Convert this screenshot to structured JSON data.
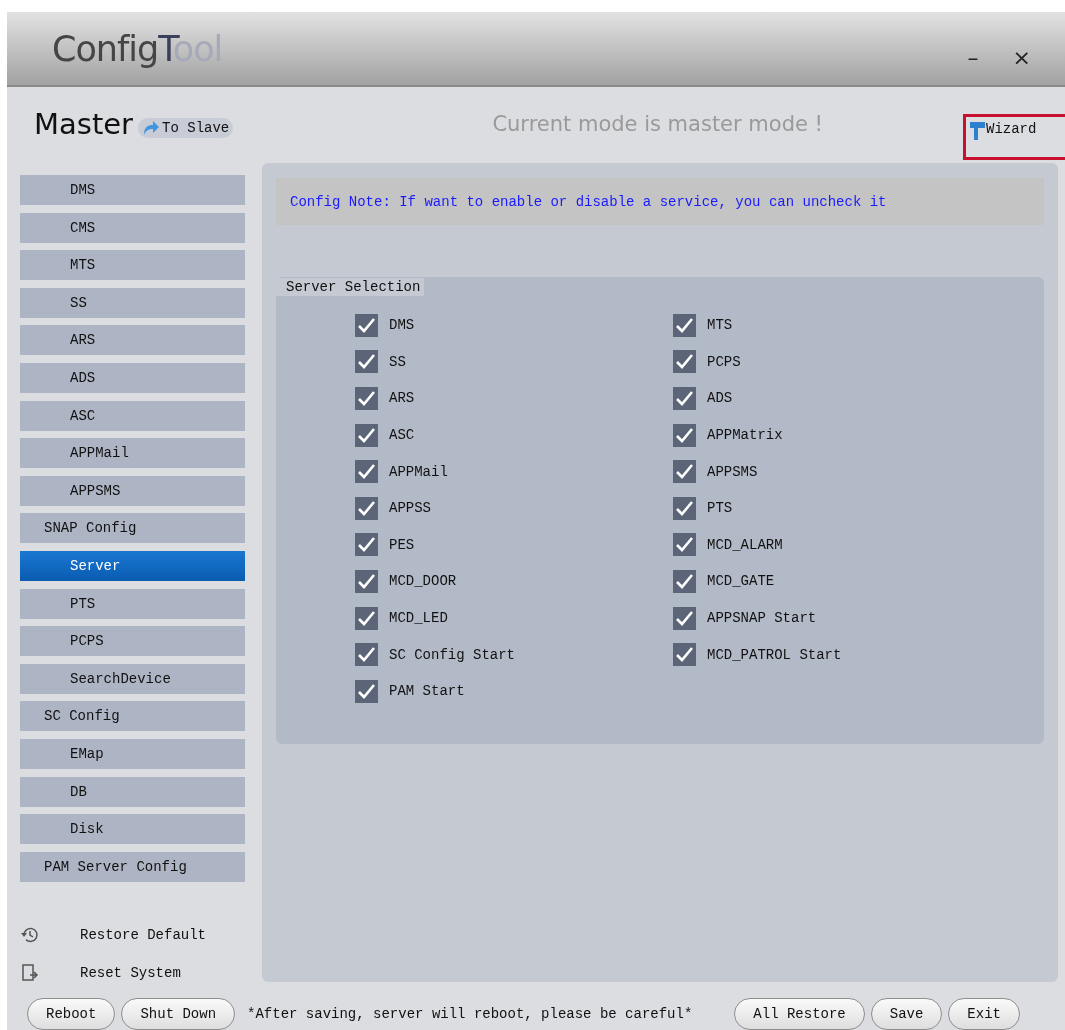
{
  "window": {
    "logo": [
      {
        "text": "Config",
        "color": "#454545"
      },
      {
        "text": "T",
        "color": "#3a3f5c"
      },
      {
        "text": "ool",
        "color": "#a6a9b8"
      }
    ],
    "controls": [
      "–",
      "×"
    ]
  },
  "header": {
    "mode": "Master",
    "switch_button": "To Slave",
    "status": "Current mode is master mode !",
    "wizard": "Wizard"
  },
  "sidebar": {
    "items": [
      {
        "label": "DMS",
        "kind": "sub",
        "selected": false
      },
      {
        "label": "CMS",
        "kind": "sub",
        "selected": false
      },
      {
        "label": "MTS",
        "kind": "sub",
        "selected": false
      },
      {
        "label": "SS",
        "kind": "sub",
        "selected": false
      },
      {
        "label": "ARS",
        "kind": "sub",
        "selected": false
      },
      {
        "label": "ADS",
        "kind": "sub",
        "selected": false
      },
      {
        "label": "ASC",
        "kind": "sub",
        "selected": false
      },
      {
        "label": "APPMail",
        "kind": "sub",
        "selected": false
      },
      {
        "label": "APPSMS",
        "kind": "sub",
        "selected": false
      },
      {
        "label": "SNAP Config",
        "kind": "group",
        "selected": false
      },
      {
        "label": "Server",
        "kind": "sub",
        "selected": true
      },
      {
        "label": "PTS",
        "kind": "sub",
        "selected": false
      },
      {
        "label": "PCPS",
        "kind": "sub",
        "selected": false
      },
      {
        "label": "SearchDevice",
        "kind": "sub",
        "selected": false
      },
      {
        "label": "SC Config",
        "kind": "group",
        "selected": false
      },
      {
        "label": "EMap",
        "kind": "sub",
        "selected": false
      },
      {
        "label": "DB",
        "kind": "sub",
        "selected": false
      },
      {
        "label": "Disk",
        "kind": "sub",
        "selected": false
      },
      {
        "label": "PAM Server Config",
        "kind": "group",
        "selected": false
      }
    ],
    "actions": [
      {
        "label": "Restore Default",
        "kind": "restore"
      },
      {
        "label": "Reset System",
        "kind": "reset"
      }
    ]
  },
  "note": "Config Note: If want to enable or disable a service, you can uncheck it",
  "server_selection": {
    "title": "Server Selection",
    "columns": [
      [
        {
          "label": "DMS",
          "checked": true
        },
        {
          "label": "SS",
          "checked": true
        },
        {
          "label": "ARS",
          "checked": true
        },
        {
          "label": "ASC",
          "checked": true
        },
        {
          "label": "APPMail",
          "checked": true
        },
        {
          "label": "APPSS",
          "checked": true
        },
        {
          "label": "PES",
          "checked": true
        },
        {
          "label": "MCD_DOOR",
          "checked": true
        },
        {
          "label": "MCD_LED",
          "checked": true
        },
        {
          "label": "SC Config Start",
          "checked": true
        },
        {
          "label": "PAM Start",
          "checked": true
        }
      ],
      [
        {
          "label": "MTS",
          "checked": true
        },
        {
          "label": "PCPS",
          "checked": true
        },
        {
          "label": "ADS",
          "checked": true
        },
        {
          "label": "APPMatrix",
          "checked": true
        },
        {
          "label": "APPSMS",
          "checked": true
        },
        {
          "label": "PTS",
          "checked": true
        },
        {
          "label": "MCD_ALARM",
          "checked": true
        },
        {
          "label": "MCD_GATE",
          "checked": true
        },
        {
          "label": "APPSNAP Start",
          "checked": true
        },
        {
          "label": "MCD_PATROL Start",
          "checked": true
        }
      ]
    ]
  },
  "footer": {
    "left_buttons": [
      "Reboot",
      "Shut Down"
    ],
    "warning": "*After saving, server will reboot, please be careful*",
    "right_buttons": [
      "All Restore",
      "Save",
      "Exit"
    ]
  }
}
